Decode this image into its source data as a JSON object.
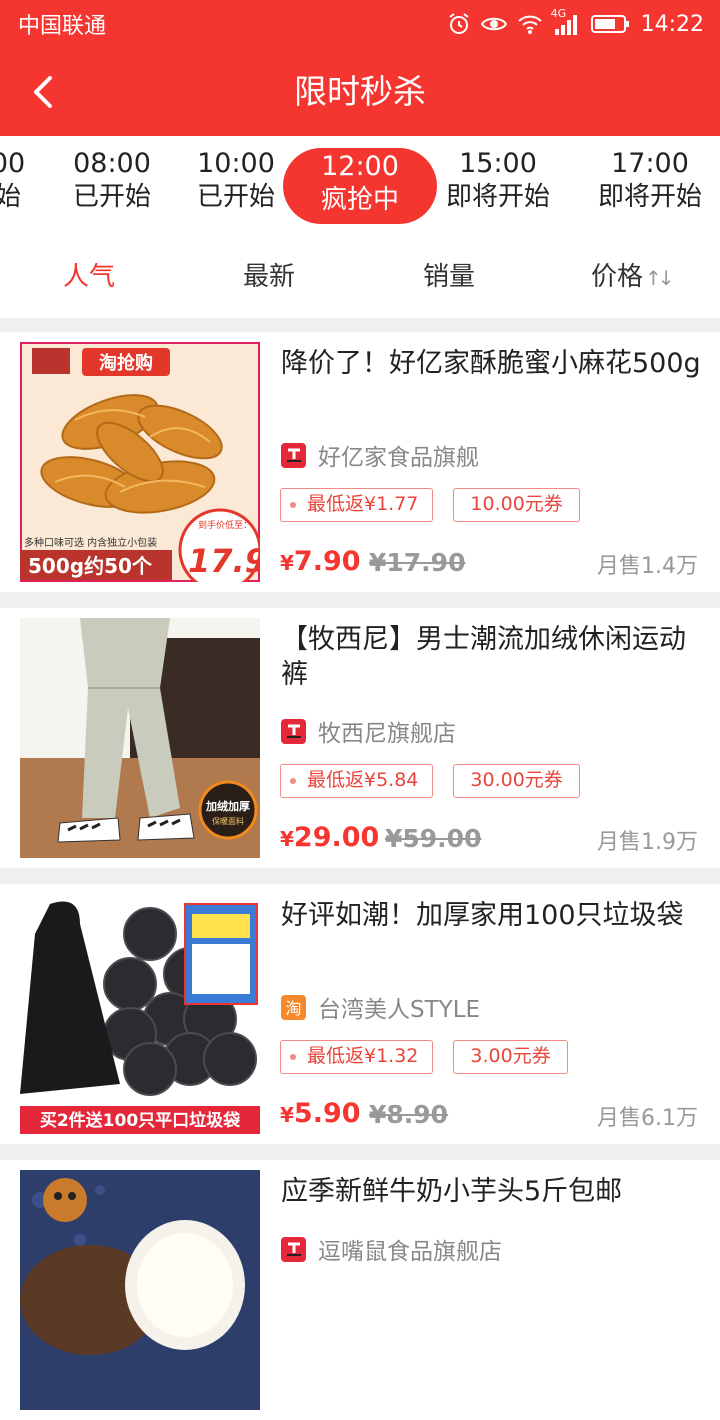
{
  "status_bar": {
    "carrier": "中国联通",
    "network": "4G",
    "time": "14:22"
  },
  "header": {
    "title": "限时秒杀",
    "back_icon": "chevron-left-icon"
  },
  "time_slots": [
    {
      "time": "00",
      "status": "始"
    },
    {
      "time": "08:00",
      "status": "已开始"
    },
    {
      "time": "10:00",
      "status": "已开始"
    },
    {
      "time": "12:00",
      "status": "疯抢中",
      "active": true
    },
    {
      "time": "15:00",
      "status": "即将开始"
    },
    {
      "time": "17:00",
      "status": "即将开始"
    }
  ],
  "sort_tabs": [
    {
      "label": "人气",
      "active": true
    },
    {
      "label": "最新"
    },
    {
      "label": "销量"
    },
    {
      "label": "价格"
    }
  ],
  "colors": {
    "brand": "#f5352f",
    "tag_border": "#f08a82",
    "muted": "#999999"
  },
  "products": [
    {
      "name": "降价了！好亿家酥脆蜜小麻花500g",
      "shop": "好亿家食品旗舰",
      "shop_icon": "tmall-icon",
      "rebate": "最低返¥1.77",
      "coupon": "10.00元券",
      "price": "7.90",
      "original_price": "¥17.90",
      "sales": "月售1.4万",
      "image_text": {
        "brand_tag": "淘抢购",
        "flavors": "多种口味可选 内含独立小包装",
        "weight": "500g约50个",
        "price_label": "到手价低至：",
        "price": "17.9"
      }
    },
    {
      "name": "【牧西尼】男士潮流加绒休闲运动裤",
      "shop": "牧西尼旗舰店",
      "shop_icon": "tmall-icon",
      "rebate": "最低返¥5.84",
      "coupon": "30.00元券",
      "price": "29.00",
      "original_price": "¥59.00",
      "sales": "月售1.9万",
      "image_text": {
        "badge_line1": "加绒加厚",
        "badge_line2": "保暖面料"
      }
    },
    {
      "name": "好评如潮！加厚家用100只垃圾袋",
      "shop": "台湾美人STYLE",
      "shop_icon": "taobao-icon",
      "rebate": "最低返¥1.32",
      "coupon": "3.00元券",
      "price": "5.90",
      "original_price": "¥8.90",
      "sales": "月售6.1万",
      "image_text": {
        "banner": "买2件送100只平口垃圾袋"
      }
    },
    {
      "name": "应季新鲜牛奶小芋头5斤包邮",
      "shop": "逗嘴鼠食品旗舰店",
      "shop_icon": "tmall-icon"
    }
  ]
}
